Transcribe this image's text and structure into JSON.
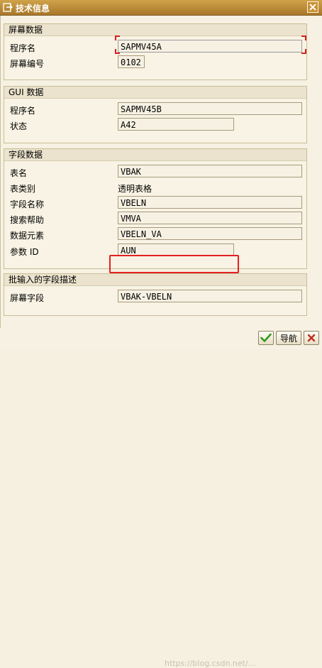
{
  "window": {
    "title": "技术信息",
    "close_label": "✕"
  },
  "screen_data": {
    "header": "屏幕数据",
    "program_label": "程序名",
    "program_value": "SAPMV45A",
    "screen_no_label": "屏幕编号",
    "screen_no_value": "0102"
  },
  "gui_data": {
    "header": "GUI 数据",
    "program_label": "程序名",
    "program_value": "SAPMV45B",
    "status_label": "状态",
    "status_value": "A42"
  },
  "field_data": {
    "header": "字段数据",
    "table_label": "表名",
    "table_value": "VBAK",
    "table_type_label": "表类别",
    "table_type_value": "透明表格",
    "field_name_label": "字段名称",
    "field_name_value": "VBELN",
    "search_help_label": "搜索帮助",
    "search_help_value": "VMVA",
    "data_element_label": "数据元素",
    "data_element_value": "VBELN_VA",
    "param_id_label": "参数 ID",
    "param_id_value": "AUN"
  },
  "batch_input": {
    "header": "批输入的字段描述",
    "screen_field_label": "屏幕字段",
    "screen_field_value": "VBAK-VBELN"
  },
  "buttons": {
    "confirm_icon": "check-icon",
    "nav_label": "导航"
  },
  "watermark": "https://blog.csdn.net/...",
  "colors": {
    "titlebar": "#b98a38",
    "highlight": "#e32121",
    "confirm_check": "#2f9a1e"
  }
}
